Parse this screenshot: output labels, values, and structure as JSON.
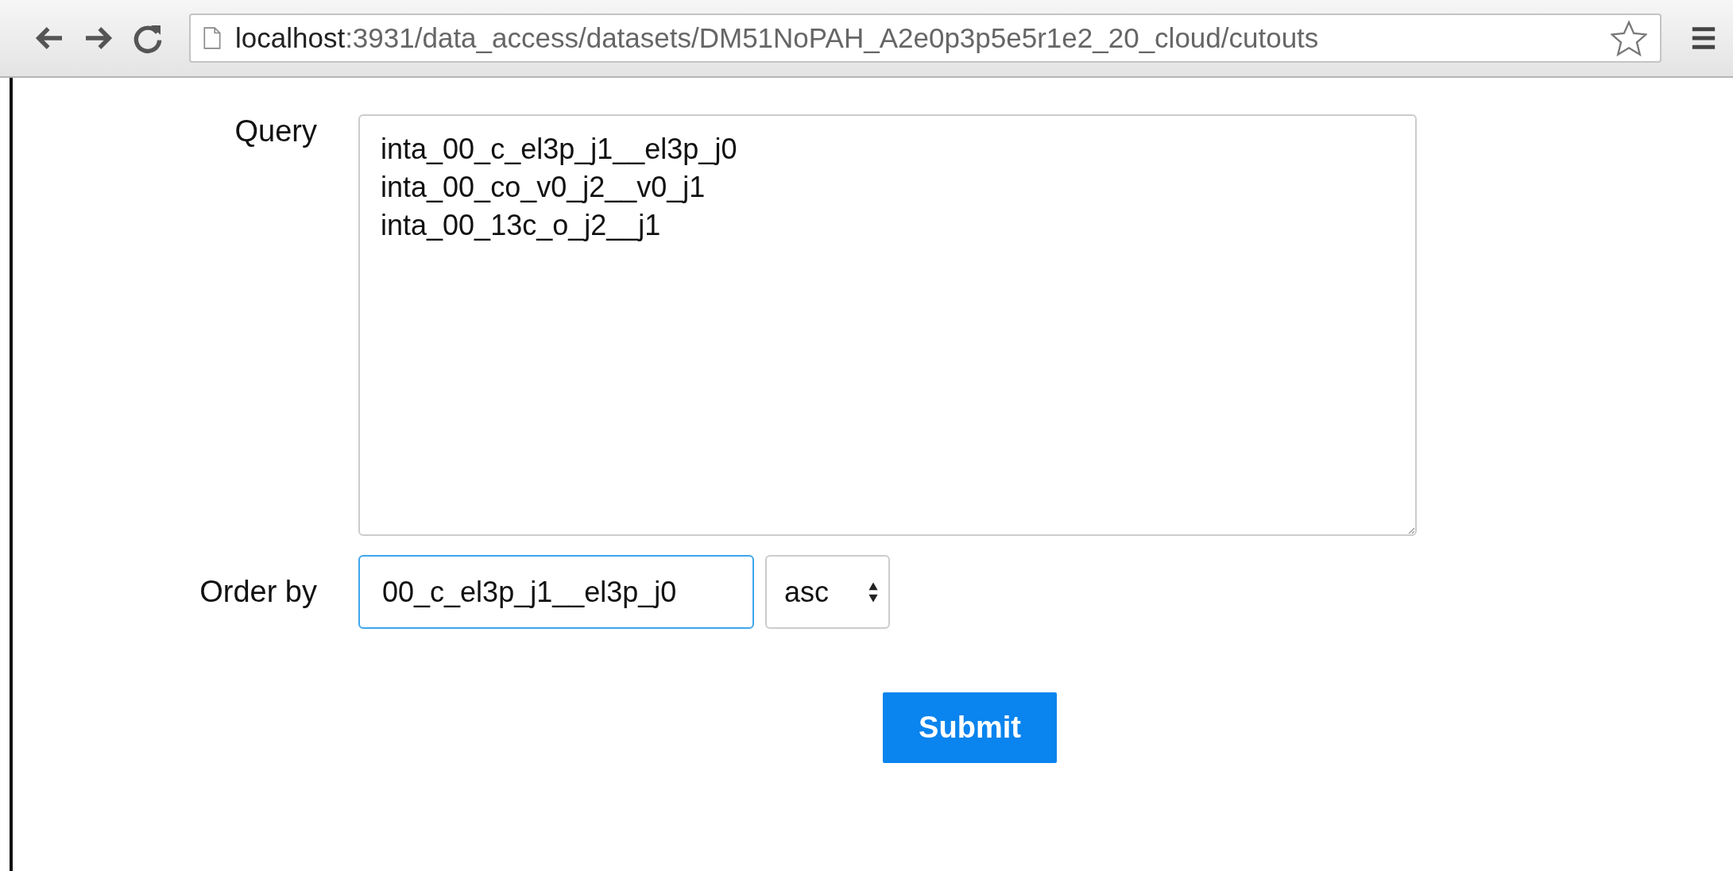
{
  "browser": {
    "url_host": "localhost",
    "url_path": ":3931/data_access/datasets/DM51NoPAH_A2e0p3p5e5r1e2_20_cloud/cutouts",
    "bookmarked": false
  },
  "form": {
    "query": {
      "label": "Query",
      "value": "inta_00_c_el3p_j1__el3p_j0\ninta_00_co_v0_j2__v0_j1\ninta_00_13c_o_j2__j1"
    },
    "order_by": {
      "label": "Order by",
      "value": "00_c_el3p_j1__el3p_j0",
      "focused": true,
      "direction": "asc"
    },
    "submit": {
      "label": "Submit"
    }
  }
}
